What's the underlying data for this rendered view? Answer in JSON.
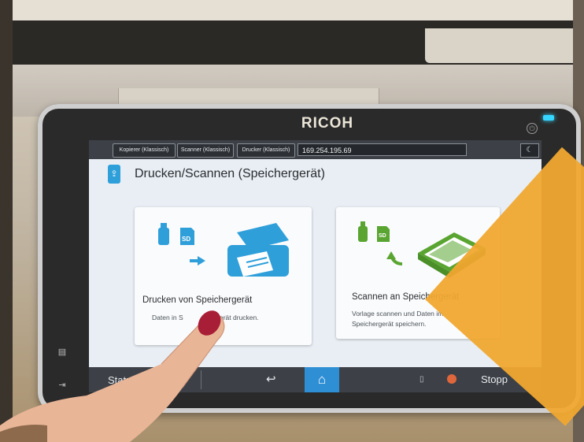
{
  "device": {
    "brand": "RICOH"
  },
  "topbar": {
    "buttons": [
      "Kopierer (Klassisch)",
      "Scanner (Klassisch)",
      "Drucker (Klassisch)"
    ],
    "ip_address": "169.254.195.69"
  },
  "header": {
    "title": "Drucken/Scannen (Speichergerät)"
  },
  "cards": [
    {
      "title": "Drucken von Speichergerät",
      "description_left": "Daten in S",
      "description_right": "erät drucken."
    },
    {
      "title": "Scannen an Speichergerät",
      "description": "Vorlage scannen und Daten im Speichergerät speichern."
    }
  ],
  "bottombar": {
    "status_label": "Statu",
    "stop_label": "Stopp"
  },
  "icons": {
    "usb": "usb-icon",
    "sd": "SD",
    "printer": "printer-icon",
    "scanner": "scanner-icon",
    "back": "back-arrow-icon",
    "home": "home-icon",
    "power": "power-icon",
    "sleep": "moon-icon"
  },
  "colors": {
    "accent_blue": "#2f9fda",
    "accent_green": "#5aa532",
    "home_blue": "#2f8fd5",
    "indicator_cyan": "#35d6ff",
    "corner_orange": "#f0a830"
  }
}
